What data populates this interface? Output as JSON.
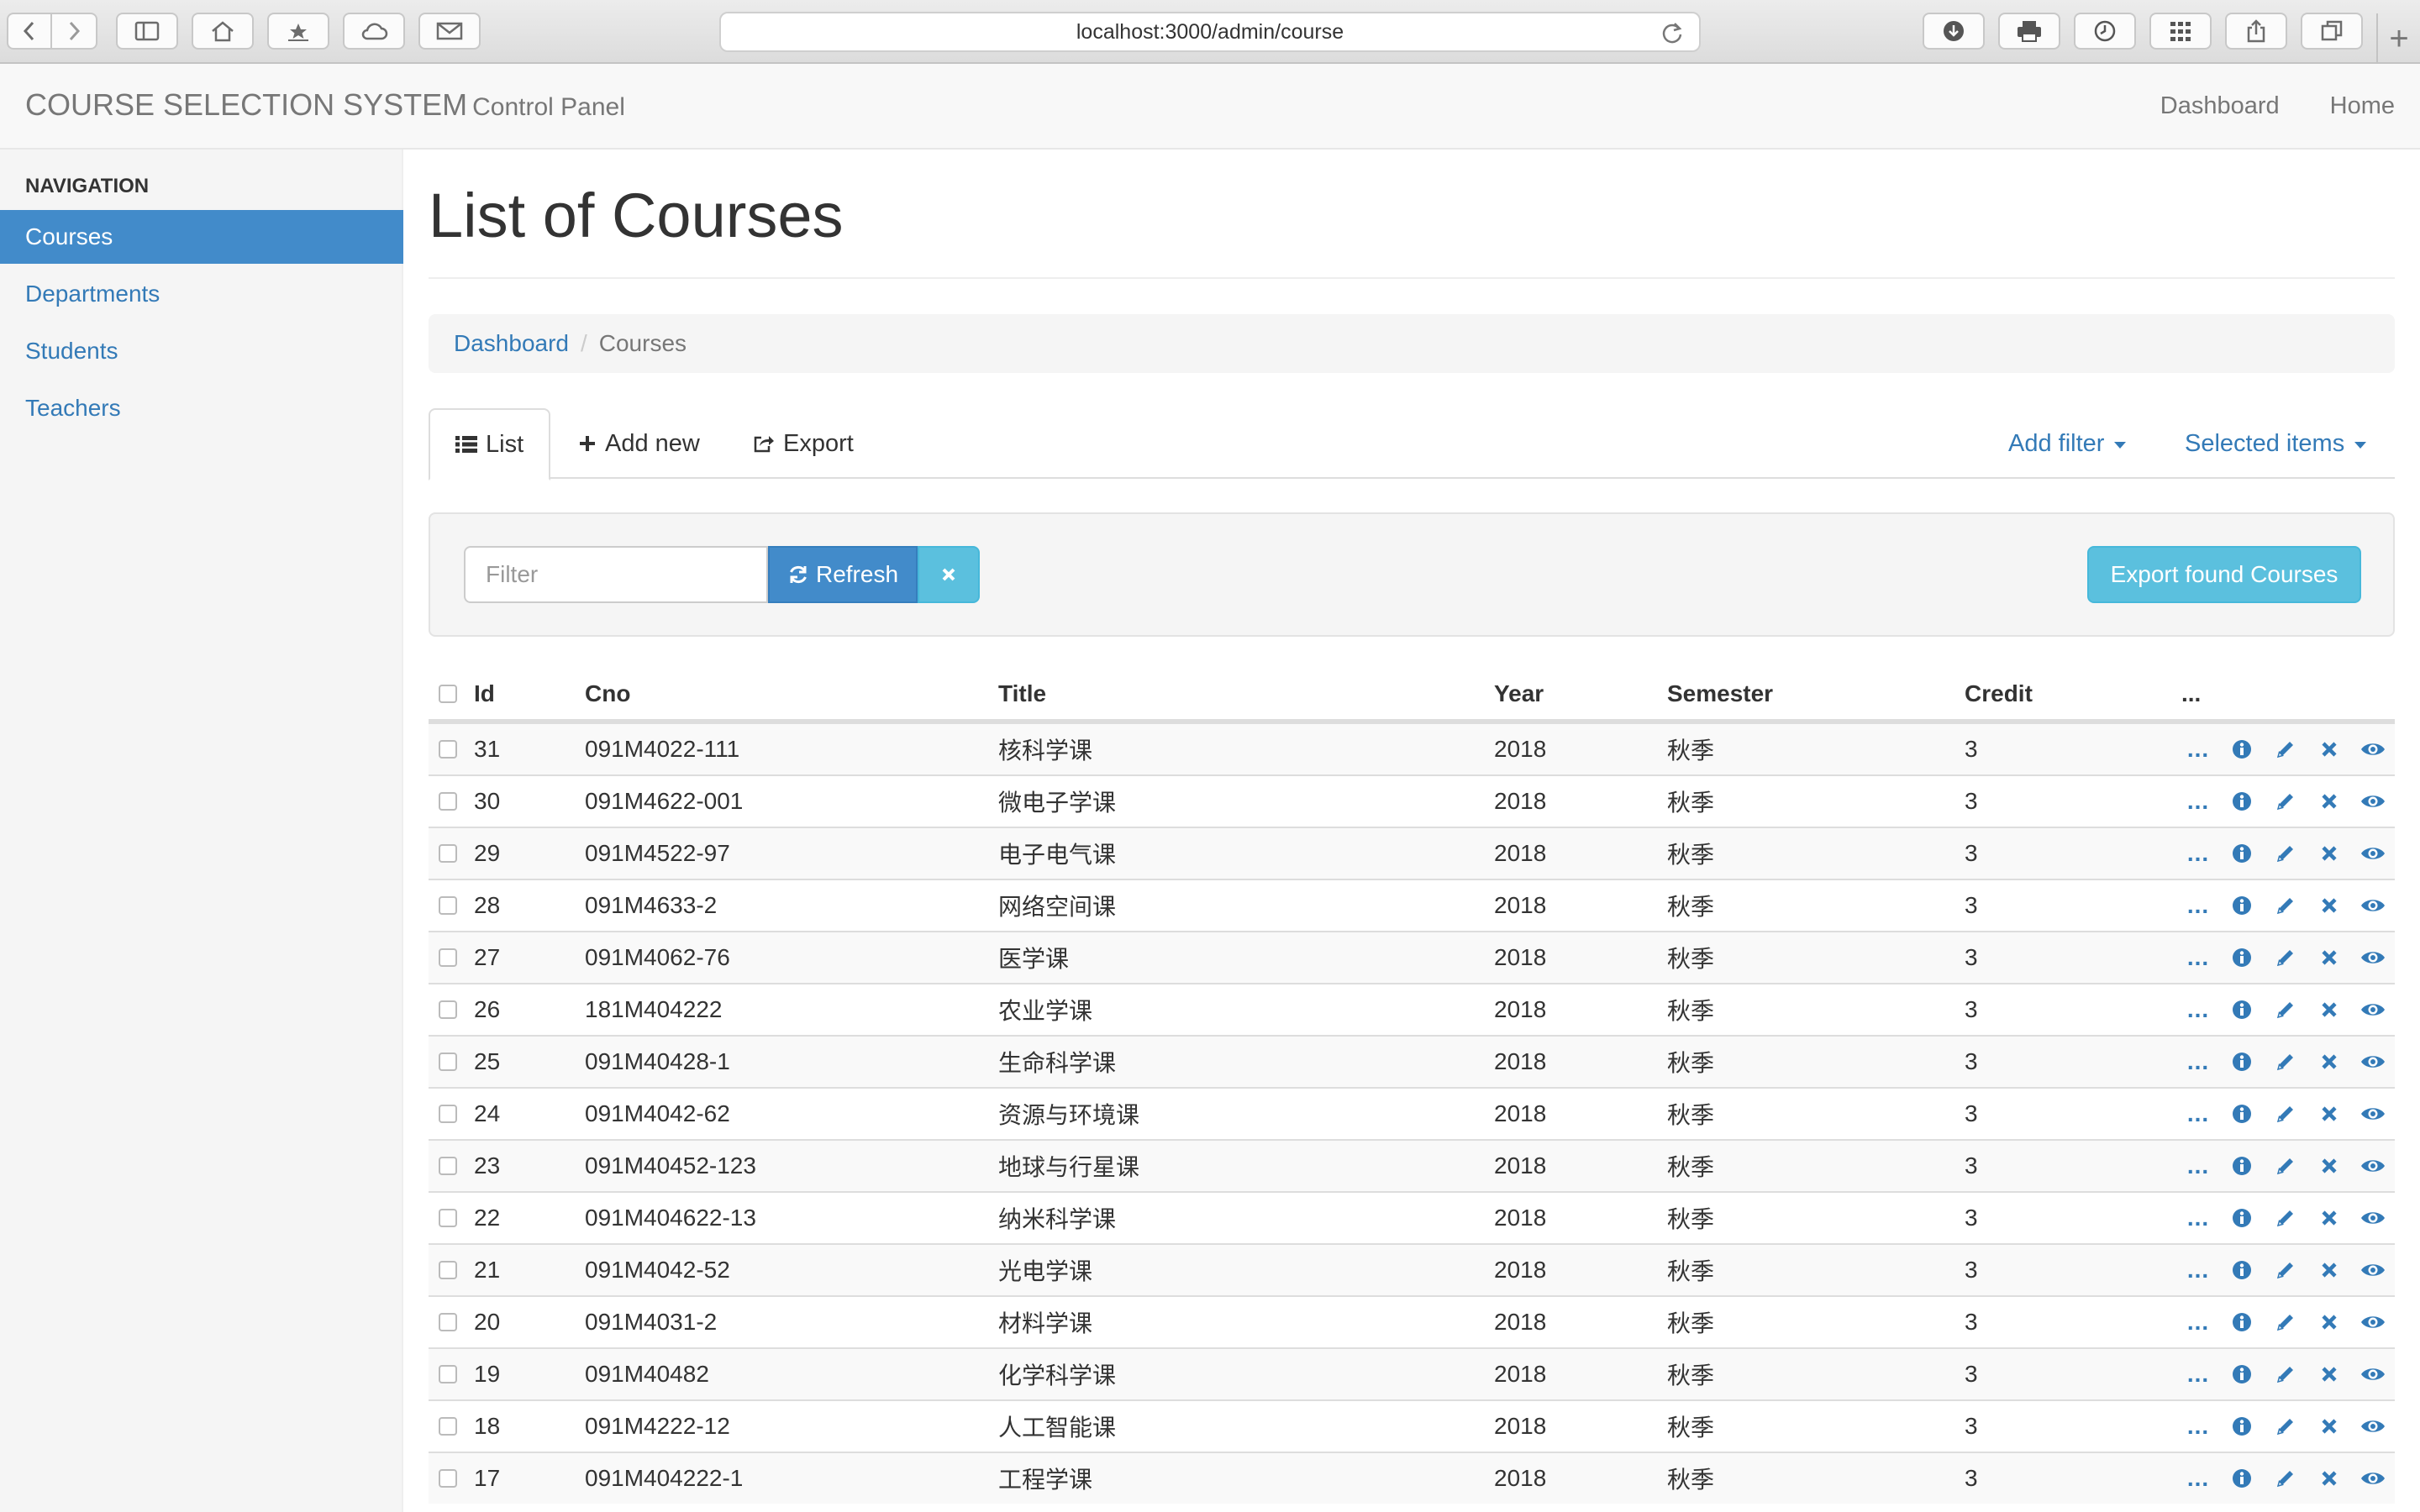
{
  "browser": {
    "url": "localhost:3000/admin/course",
    "new_tab_label": "+"
  },
  "app": {
    "brand": "COURSE SELECTION SYSTEM",
    "brand_sub": "Control Panel",
    "topnav": [
      "Dashboard",
      "Home"
    ]
  },
  "sidebar": {
    "header": "NAVIGATION",
    "items": [
      {
        "label": "Courses",
        "active": true
      },
      {
        "label": "Departments",
        "active": false
      },
      {
        "label": "Students",
        "active": false
      },
      {
        "label": "Teachers",
        "active": false
      }
    ]
  },
  "main": {
    "title": "List of Courses",
    "breadcrumb": {
      "link": "Dashboard",
      "separator": "/",
      "current": "Courses"
    },
    "tabs": {
      "list": "List",
      "add_new": "Add new",
      "export": "Export",
      "add_filter": "Add filter",
      "selected_items": "Selected items"
    },
    "filter": {
      "placeholder": "Filter",
      "refresh_label": "Refresh",
      "export_label": "Export found Courses"
    }
  },
  "table": {
    "columns": {
      "id": "Id",
      "cno": "Cno",
      "title": "Title",
      "year": "Year",
      "semester": "Semester",
      "credit": "Credit",
      "actions": "..."
    },
    "action_dots": "...",
    "rows": [
      {
        "id": "31",
        "cno": "091M4022-111",
        "title": "核科学课",
        "year": "2018",
        "semester": "秋季",
        "credit": "3"
      },
      {
        "id": "30",
        "cno": "091M4622-001",
        "title": "微电子学课",
        "year": "2018",
        "semester": "秋季",
        "credit": "3"
      },
      {
        "id": "29",
        "cno": "091M4522-97",
        "title": "电子电气课",
        "year": "2018",
        "semester": "秋季",
        "credit": "3"
      },
      {
        "id": "28",
        "cno": "091M4633-2",
        "title": "网络空间课",
        "year": "2018",
        "semester": "秋季",
        "credit": "3"
      },
      {
        "id": "27",
        "cno": "091M4062-76",
        "title": "医学课",
        "year": "2018",
        "semester": "秋季",
        "credit": "3"
      },
      {
        "id": "26",
        "cno": "181M404222",
        "title": "农业学课",
        "year": "2018",
        "semester": "秋季",
        "credit": "3"
      },
      {
        "id": "25",
        "cno": "091M40428-1",
        "title": "生命科学课",
        "year": "2018",
        "semester": "秋季",
        "credit": "3"
      },
      {
        "id": "24",
        "cno": "091M4042-62",
        "title": "资源与环境课",
        "year": "2018",
        "semester": "秋季",
        "credit": "3"
      },
      {
        "id": "23",
        "cno": "091M40452-123",
        "title": "地球与行星课",
        "year": "2018",
        "semester": "秋季",
        "credit": "3"
      },
      {
        "id": "22",
        "cno": "091M404622-13",
        "title": "纳米科学课",
        "year": "2018",
        "semester": "秋季",
        "credit": "3"
      },
      {
        "id": "21",
        "cno": "091M4042-52",
        "title": "光电学课",
        "year": "2018",
        "semester": "秋季",
        "credit": "3"
      },
      {
        "id": "20",
        "cno": "091M4031-2",
        "title": "材料学课",
        "year": "2018",
        "semester": "秋季",
        "credit": "3"
      },
      {
        "id": "19",
        "cno": "091M40482",
        "title": "化学科学课",
        "year": "2018",
        "semester": "秋季",
        "credit": "3"
      },
      {
        "id": "18",
        "cno": "091M4222-12",
        "title": "人工智能课",
        "year": "2018",
        "semester": "秋季",
        "credit": "3"
      },
      {
        "id": "17",
        "cno": "091M404222-1",
        "title": "工程学课",
        "year": "2018",
        "semester": "秋季",
        "credit": "3"
      }
    ]
  },
  "colors": {
    "accent": "#337ab7",
    "active_nav": "#428bca",
    "info_button": "#5bc0de"
  },
  "icons": [
    "back-icon",
    "forward-icon",
    "sidebar-icon",
    "home-icon",
    "bookmark-icon",
    "cloud-icon",
    "mail-icon",
    "reload-icon",
    "download-icon",
    "print-icon",
    "history-icon",
    "grid-icon",
    "share-icon",
    "tabs-icon",
    "list-icon",
    "plus-icon",
    "export-icon",
    "refresh-icon",
    "close-icon",
    "info-icon",
    "pencil-icon",
    "delete-icon",
    "eye-icon"
  ]
}
